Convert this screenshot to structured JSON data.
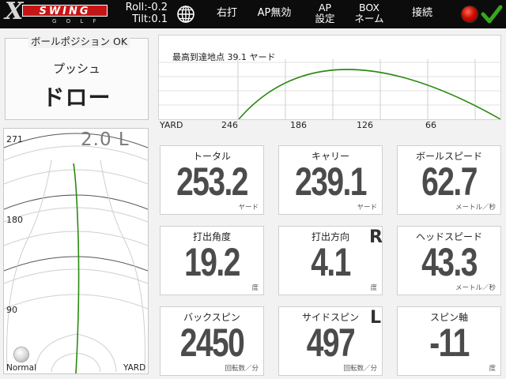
{
  "header": {
    "logo_x": "X",
    "logo_swing": "SWING",
    "logo_golf": "G O L F",
    "roll": "Roll:-0.2",
    "tilt": "Tilt:0.1",
    "globe_icon": "globe-icon",
    "buttons": {
      "right_hand": "右打",
      "ap_disabled": "AP無効",
      "ap_settings_line1": "AP",
      "ap_settings_line2": "設定",
      "box_line1": "BOX",
      "box_line2": "ネーム",
      "connect": "接続"
    },
    "status_color": "#d00c00",
    "check_color": "#37a81c"
  },
  "ball_position": {
    "title": "ボールポジション OK",
    "type": "プッシュ",
    "shape": "ドロー"
  },
  "trajectory": {
    "max_height_label": "最高到達地点 39.1 ヤード",
    "axis_unit": "YARD",
    "ticks": [
      "246",
      "186",
      "126",
      "66"
    ],
    "line_color": "#2b8a10"
  },
  "top_view": {
    "distance": "2.0 L",
    "ticks": [
      "271",
      "180",
      "90"
    ],
    "mode": "Normal",
    "unit": "YARD",
    "line_color": "#2b8a10"
  },
  "stats": {
    "total": {
      "label": "トータル",
      "value": "253.2",
      "unit": "ヤード"
    },
    "carry": {
      "label": "キャリー",
      "value": "239.1",
      "unit": "ヤード"
    },
    "ball_speed": {
      "label": "ボールスピード",
      "value": "62.7",
      "unit": "メートル／秒"
    },
    "launch_angle": {
      "label": "打出角度",
      "value": "19.2",
      "unit": "度"
    },
    "launch_direction": {
      "label": "打出方向",
      "value": "4.1",
      "unit": "度",
      "side": "R"
    },
    "head_speed": {
      "label": "ヘッドスピード",
      "value": "43.3",
      "unit": "メートル／秒"
    },
    "back_spin": {
      "label": "バックスピン",
      "value": "2450",
      "unit": "回転数／分"
    },
    "side_spin": {
      "label": "サイドスピン",
      "value": "497",
      "unit": "回転数／分",
      "side": "L"
    },
    "spin_axis": {
      "label": "スピン軸",
      "value": "-11",
      "unit": "度"
    }
  }
}
